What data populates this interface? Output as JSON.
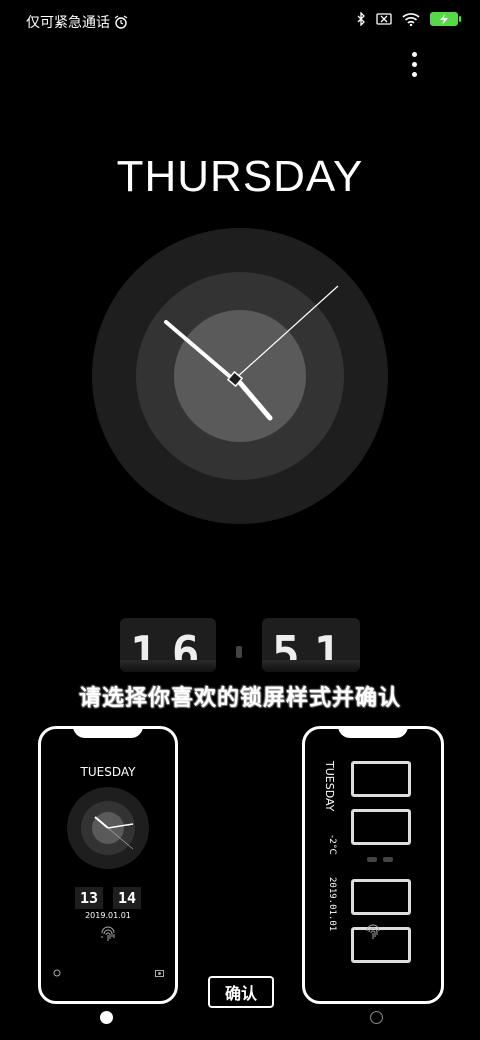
{
  "status": {
    "carrier_text": "仅可紧急通话",
    "alarm_icon": "alarm-clock-icon",
    "bluetooth_icon": "bluetooth-icon",
    "sim_icon": "no-sim-icon",
    "wifi_icon": "wifi-icon",
    "battery_icon": "battery-charging-icon",
    "battery_color": "#57d84a"
  },
  "lock": {
    "day": "THURSDAY",
    "digital_hours": "16",
    "digital_minutes": "51"
  },
  "instruction": "请选择你喜欢的锁屏样式并确认",
  "previews": {
    "left": {
      "day": "TUESDAY",
      "hours": "13",
      "minutes": "14",
      "date": "2019.01.01"
    },
    "right": {
      "day": "TUESDAY",
      "temp": "-2°C",
      "date": "2019.01.01"
    }
  },
  "confirm_label": "确认",
  "pager": {
    "count": 2,
    "active": 0
  }
}
